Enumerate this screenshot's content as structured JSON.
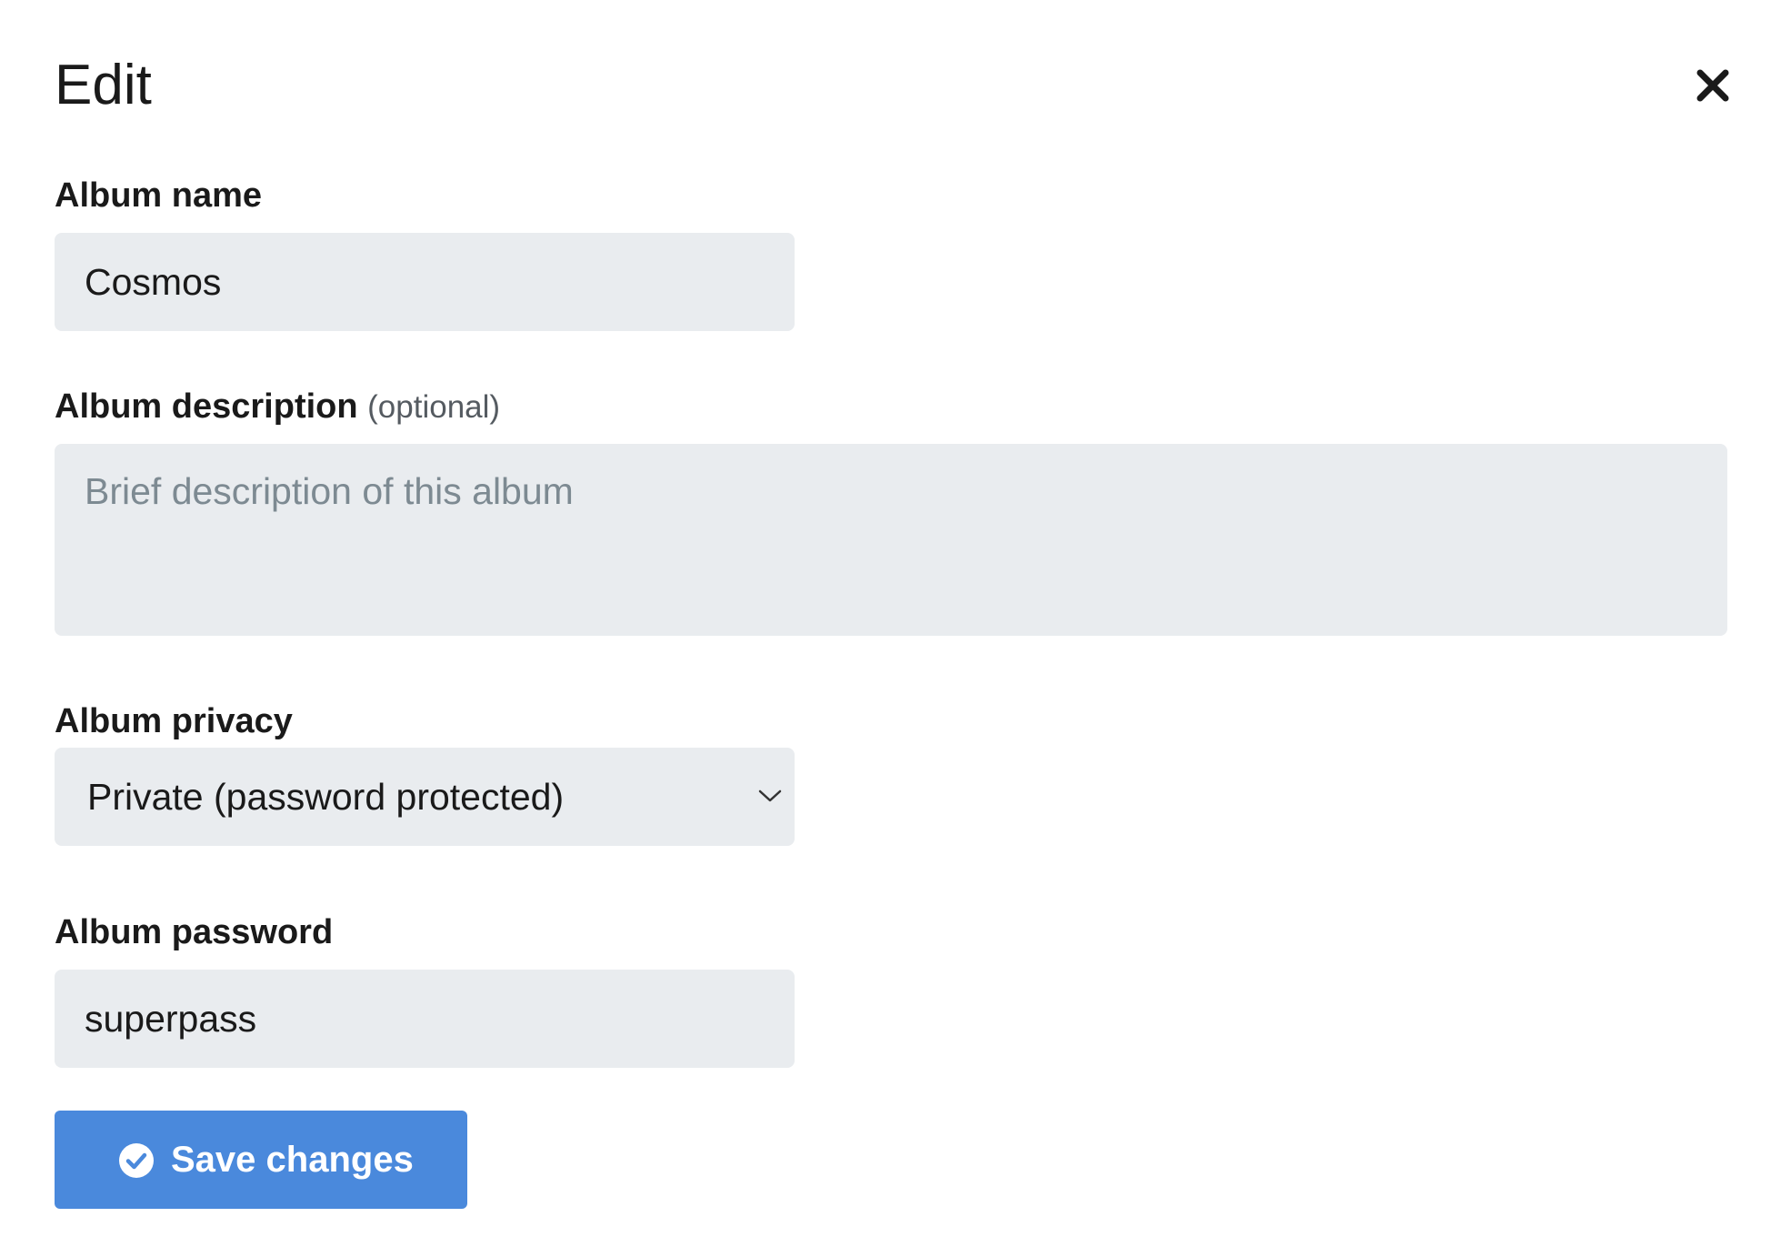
{
  "dialog": {
    "title": "Edit",
    "close_icon": "close-icon"
  },
  "album_name": {
    "label": "Album name",
    "value": "Cosmos"
  },
  "album_description": {
    "label": "Album description",
    "optional_label": "(optional)",
    "value": "",
    "placeholder": "Brief description of this album"
  },
  "album_privacy": {
    "label": "Album privacy",
    "selected": "Private (password protected)",
    "icon": "chevron-down-icon"
  },
  "album_password": {
    "label": "Album password",
    "value": "superpass"
  },
  "save": {
    "label": "Save changes",
    "icon": "check-circle-icon",
    "color": "#4a89dc"
  },
  "colors": {
    "field_background": "#e9ecef",
    "placeholder": "#7d8a92",
    "text": "#1a1a1a"
  }
}
